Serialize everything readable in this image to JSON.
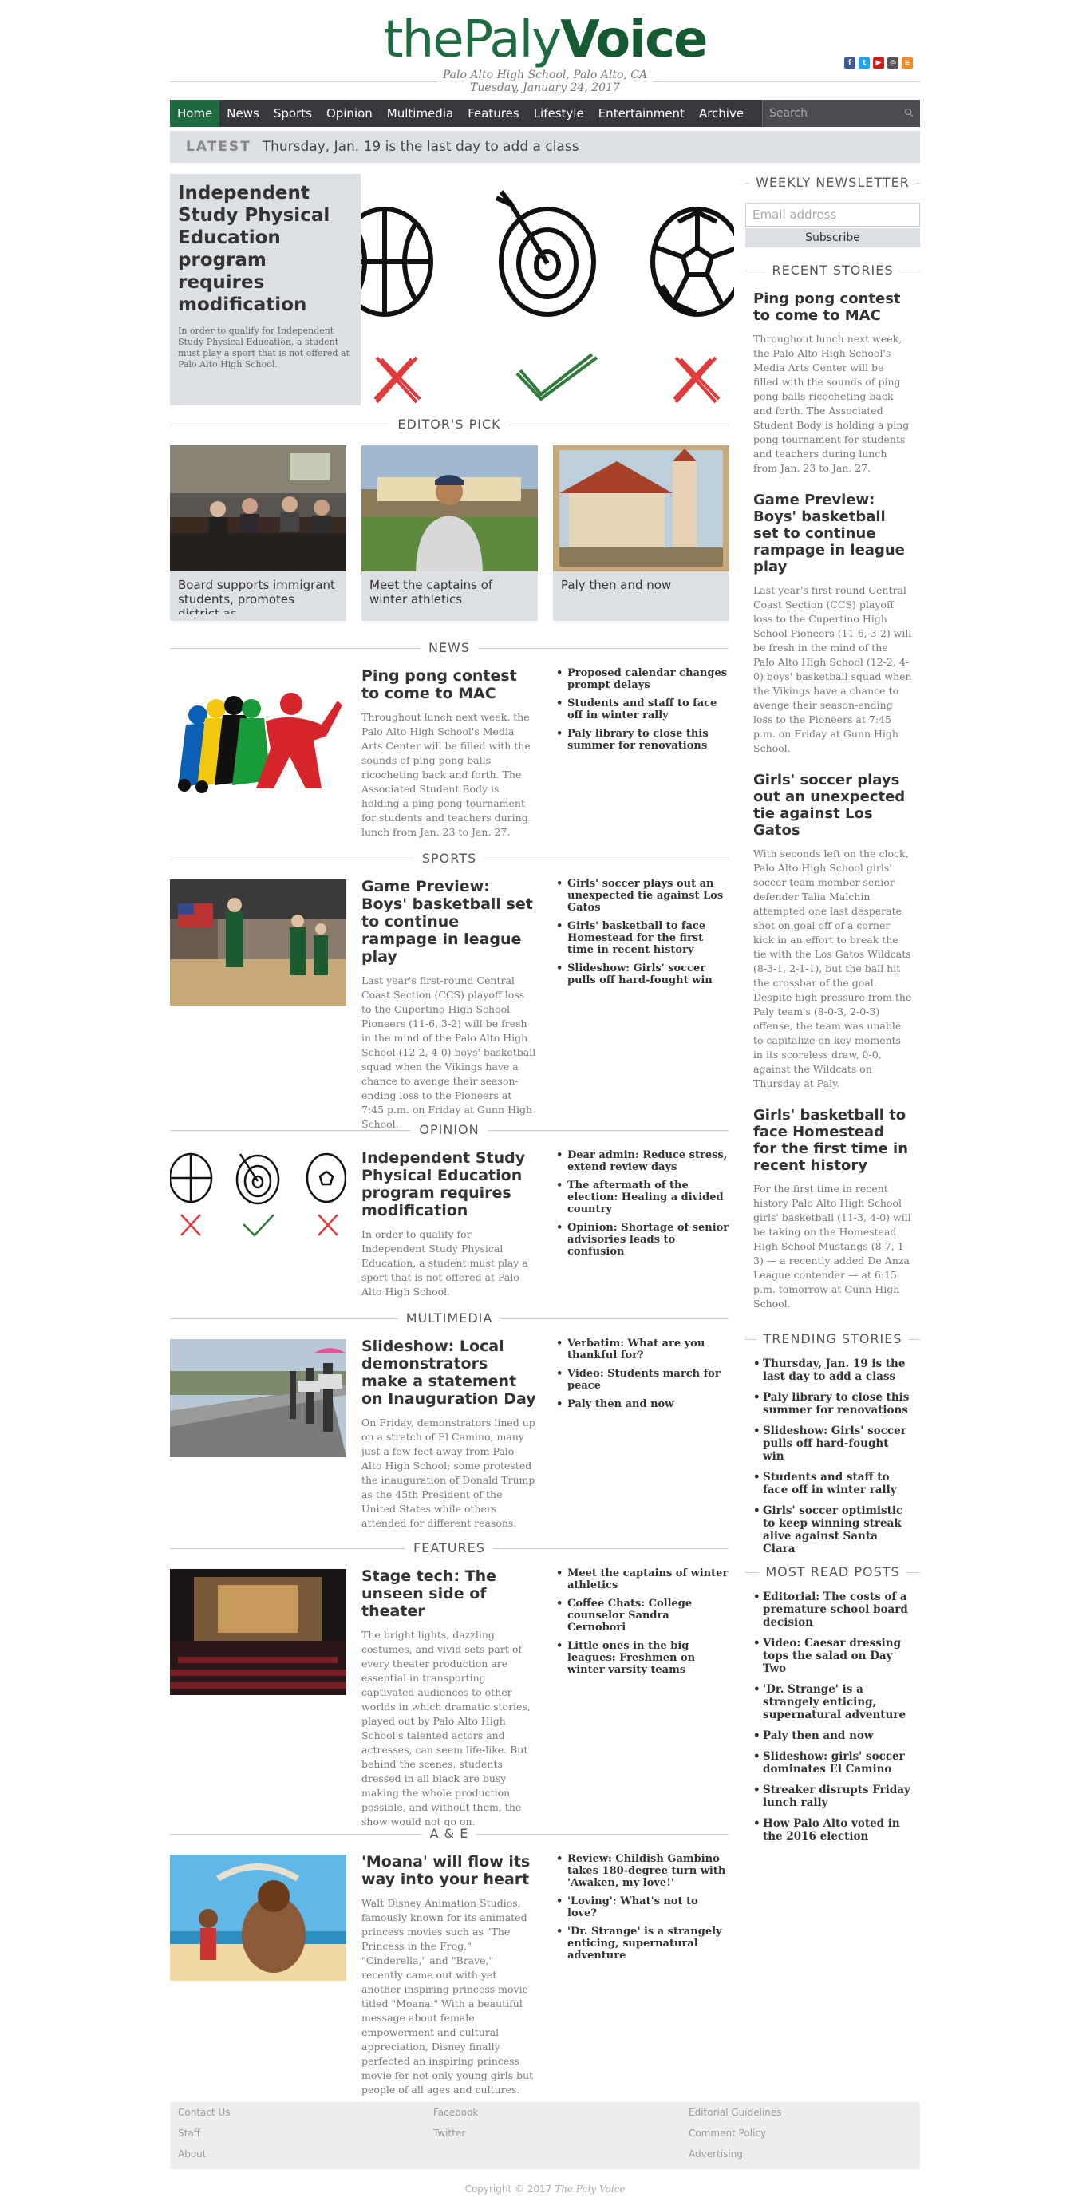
{
  "header": {
    "logo_part1": "thePaly",
    "logo_part2": "Voice",
    "location": "Palo Alto High School, Palo Alto, CA",
    "date": "Tuesday, January 24, 2017",
    "social_icons": [
      "facebook-icon",
      "twitter-icon",
      "youtube-icon",
      "instagram-icon",
      "rss-icon"
    ]
  },
  "nav": {
    "items": [
      "Home",
      "News",
      "Sports",
      "Opinion",
      "Multimedia",
      "Features",
      "Lifestyle",
      "Entertainment",
      "Archive"
    ],
    "search_placeholder": "Search"
  },
  "latest": {
    "label": "LATEST",
    "text": "Thursday, Jan. 19 is the last day to add a class"
  },
  "featured": {
    "title": "Independent Study Physical Education program requires modification",
    "excerpt": "In order to qualify for Independent Study Physical Education, a student must play a sport that is not offered at Palo Alto High School."
  },
  "editors_pick": {
    "heading": "EDITOR'S PICK",
    "items": [
      {
        "caption": "Board supports immigrant students, promotes district as"
      },
      {
        "caption": "Meet the captains of winter athletics"
      },
      {
        "caption": "Paly then and now"
      }
    ]
  },
  "sections": {
    "news": {
      "heading": "NEWS",
      "title": "Ping pong contest to come to MAC",
      "excerpt": "Throughout lunch next week, the Palo Alto High School's Media Arts Center will be filled with the sounds of ping pong balls ricocheting back and forth. The Associated Student Body is holding a ping pong tournament for students and teachers during lunch from Jan. 23 to Jan. 27.",
      "list": [
        "Proposed calendar changes prompt delays",
        "Students and staff to face off in winter rally",
        "Paly library to close this summer for renovations"
      ]
    },
    "sports": {
      "heading": "SPORTS",
      "title": "Game Preview: Boys' basketball set to continue rampage in league play",
      "excerpt": "Last year's first-round Central Coast Section (CCS) playoff loss to the Cupertino High School Pioneers (11-6, 3-2) will be fresh in the mind of the Palo Alto High School (12-2, 4-0) boys' basketball squad when the Vikings have a chance to avenge their season-ending loss to the Pioneers at 7:45 p.m. on Friday at Gunn High School.",
      "list": [
        "Girls' soccer plays out an unexpected tie against Los Gatos",
        "Girls' basketball to face Homestead for the first time in recent history",
        "Slideshow: Girls' soccer pulls off hard-fought win"
      ]
    },
    "opinion": {
      "heading": "OPINION",
      "title": "Independent Study Physical Education program requires modification",
      "excerpt": "In order to qualify for Independent Study Physical Education, a student must play a sport that is not offered at Palo Alto High School.",
      "list": [
        "Dear admin: Reduce stress, extend review days",
        "The aftermath of the election: Healing a divided country",
        "Opinion: Shortage of senior advisories leads to confusion"
      ]
    },
    "multimedia": {
      "heading": "MULTIMEDIA",
      "title": "Slideshow: Local demonstrators make a statement on Inauguration Day",
      "excerpt": "On Friday, demonstrators lined up on a stretch of El Camino, many just a few feet away from Palo Alto High School; some protested the inauguration of Donald Trump as the 45th President of the United States while others attended for different reasons.",
      "list": [
        "Verbatim: What are you thankful for?",
        "Video: Students march for peace",
        "Paly then and now"
      ]
    },
    "features": {
      "heading": "FEATURES",
      "title": "Stage tech: The unseen side of theater",
      "excerpt": "The bright lights, dazzling costumes, and vivid sets part of every theater production are essential in transporting captivated audiences to other worlds in which dramatic stories, played out by Palo Alto High School's talented actors and actresses, can seem life-like. But behind the scenes, students dressed in all black are busy making the whole production possible, and without them, the show would not go on.",
      "list": [
        "Meet the captains of winter athletics",
        "Coffee Chats: College counselor Sandra Cernobori",
        "Little ones in the big leagues: Freshmen on winter varsity teams"
      ]
    },
    "ae": {
      "heading": "A & E",
      "title": "'Moana' will flow its way into your heart",
      "excerpt": "Walt Disney Animation Studios, famously known for its animated princess movies such as \"The Princess in the Frog,\" \"Cinderella,\" and \"Brave,\" recently came out with yet another inspiring princess movie titled \"Moana.\" With a beautiful message about female empowerment and cultural appreciation, Disney finally perfected an inspiring princess movie for not only young girls but people of all ages and cultures.",
      "list": [
        "Review: Childish Gambino takes 180-degree turn with 'Awaken, my love!'",
        "'Loving': What's not to love?",
        "'Dr. Strange' is a strangely enticing, supernatural adventure"
      ]
    }
  },
  "sidebar": {
    "newsletter_heading": "WEEKLY NEWSLETTER",
    "email_placeholder": "Email address",
    "subscribe_label": "Subscribe",
    "recent_heading": "RECENT STORIES",
    "recent": [
      {
        "title": "Ping pong contest to come to MAC",
        "excerpt": "Throughout lunch next week, the Palo Alto High School's Media Arts Center will be filled with the sounds of ping pong balls ricocheting back and forth. The Associated Student Body is holding a ping pong tournament for students and teachers during lunch from Jan. 23 to Jan. 27."
      },
      {
        "title": "Game Preview: Boys' basketball set to continue rampage in league play",
        "excerpt": "Last year's first-round Central Coast Section (CCS) playoff loss to the Cupertino High School Pioneers (11-6, 3-2) will be fresh in the mind of the Palo Alto High School (12-2, 4-0) boys' basketball squad when the Vikings have a chance to avenge their season-ending loss to the Pioneers at 7:45 p.m. on Friday at Gunn High School."
      },
      {
        "title": "Girls' soccer plays out an unexpected tie against Los Gatos",
        "excerpt": "With seconds left on the clock, Palo Alto High School girls' soccer team member senior defender Talia Malchin attempted one last desperate shot on goal off of a corner kick in an effort to break the tie with the Los Gatos Wildcats (8-3-1, 2-1-1), but the ball hit the crossbar of the goal. Despite high pressure from the Paly team's (8-0-3, 2-0-3) offense, the team was unable to capitalize on key moments in its scoreless draw, 0-0, against the Wildcats on Thursday at Paly."
      },
      {
        "title": "Girls' basketball to face Homestead for the first time in recent history",
        "excerpt": "For the first time in recent history Palo Alto High School girls' basketball (11-3, 4-0) will be taking on the Homestead High School Mustangs (8-7, 1-3) — a recently added De Anza League contender — at 6:15 p.m. tomorrow at Gunn High School."
      }
    ],
    "trending_heading": "TRENDING STORIES",
    "trending": [
      "Thursday, Jan. 19 is the last day to add a class",
      "Paly library to close this summer for renovations",
      "Slideshow: Girls' soccer pulls off hard-fought win",
      "Students and staff to face off in winter rally",
      "Girls' soccer optimistic to keep winning streak alive against Santa Clara"
    ],
    "mostread_heading": "MOST READ POSTS",
    "mostread": [
      "Editorial: The costs of a premature school board decision",
      "Video: Caesar dressing tops the salad on Day Two",
      "'Dr. Strange' is a strangely enticing, supernatural adventure",
      "Paly then and now",
      "Slideshow: girls' soccer dominates El Camino",
      "Streaker disrupts Friday lunch rally",
      "How Palo Alto voted in the 2016 election"
    ]
  },
  "footer": {
    "col1": [
      "Contact Us",
      "Staff",
      "About"
    ],
    "col2": [
      "Facebook",
      "Twitter"
    ],
    "col3": [
      "Editorial Guidelines",
      "Comment Policy",
      "Advertising"
    ],
    "copyright": "Copyright © 2017",
    "copyright_name": "The Paly Voice"
  },
  "colors": {
    "brand_green": "#1e6b3f",
    "nav_bg": "#36383b",
    "panel_gray": "#dcdfe3",
    "cross_red": "#e03a3a",
    "check_green": "#2f7a3a"
  }
}
